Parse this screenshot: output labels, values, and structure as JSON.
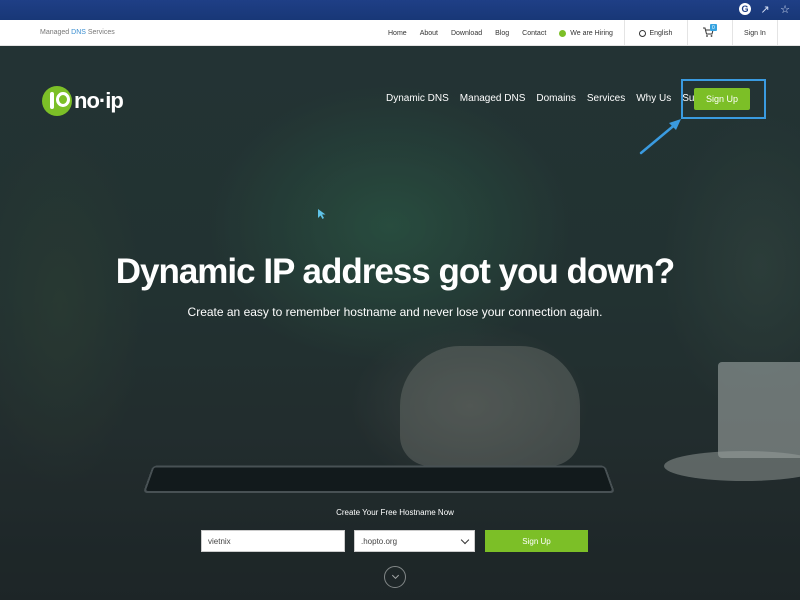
{
  "utility_bar": {
    "tagline_prefix": "Managed ",
    "tagline_highlight": "DNS",
    "tagline_suffix": " Services",
    "links": [
      "Home",
      "About",
      "Download",
      "Blog",
      "Contact"
    ],
    "hiring": "We are Hiring",
    "language": "English",
    "cart_count": "0",
    "sign_in": "Sign In"
  },
  "brand": {
    "logo_text": "no·ip",
    "accent": "#7cbf27"
  },
  "main_nav": {
    "items": [
      "Dynamic DNS",
      "Managed DNS",
      "Domains",
      "Services",
      "Why Us",
      "Support"
    ],
    "signup": "Sign Up"
  },
  "hero": {
    "headline": "Dynamic IP address got you down?",
    "subline": "Create an easy to remember hostname and never lose your connection again."
  },
  "form": {
    "title": "Create Your Free Hostname Now",
    "hostname_value": "vietnix",
    "domain_selected": ".hopto.org",
    "submit": "Sign Up"
  },
  "annotation": {
    "highlight_color": "#3a9be0"
  }
}
